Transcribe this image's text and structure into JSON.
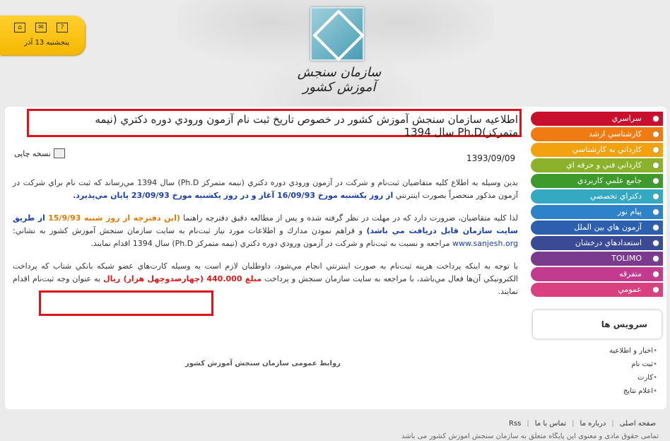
{
  "corner": {
    "date": "پنجشنبه 13 آذر",
    "icons": [
      "help-icon",
      "mail-icon",
      "home-icon"
    ]
  },
  "logo": {
    "text": "سازمان سنجش آموزش کشور"
  },
  "article": {
    "title": "اطلاعيه سازمان سنجش آموزش كشور در خصوص تاريخ ثبت نام آزمون ورودي دوره دكتري (نيمه متمركز)Ph.D سال 1394",
    "print_label": "نسخه چاپی",
    "date": "1393/09/09",
    "p1_a": "بدين وسيله به اطلاع كليه متقاضيان ثبت‌نام و شركت در آزمون ورودي دوره دكتري (نيمه متمركز Ph.D) سال 1394 مي‌رساند كه ثبت نام براي شركت در آزمون مذكور منحصراً بصورت اينترنتي",
    "p1_b": "از روز يكشنبه مورخ 16/09/93 آغاز و در روز يكشنبه مورخ 23/09/93 پايان مي‌پذيرد.",
    "p2_a": "لذا كليه متقاضيان، ضرورت دارد كه در مهلت در نظر گرفته شده و پس از مطالعه دقيق دفترچه راهنما",
    "p2_b": "(اين دفترچه از روز شنبه 15/9/93",
    "p2_c": "از طريق سايت سازمان قابل دريافت مي باشد)",
    "p2_d": "و فراهم نمودن مدارك و اطلاعات مورد نياز ثبت‌نام به سايت سازمان سنجش آموزش كشور به نشاني:",
    "p2_link": "www.sanjesh.org",
    "p2_e": "مراجعه و نسبت به ثبت‌نام و شركت در آزمون ورودي دوره دكتري (نيمه متمركز Ph.D) سال 1394 اقدام نمايند.",
    "p3_a": "با توجه به اينكه پرداخت هزينه ثبت‌نام به صورت اينترنتي انجام مي‌شود، داوطلبان لازم است به وسيله كارت‌هاي عضو شبكه بانكي شتاب كه پرداخت الكترونيكي آن‌ها فعال مي‌باشد، با مراجعه به سايت سازمان سنجش و پرداخت",
    "p3_b": "مبلغ 440.000 (چهارصدوچهل هزار) ريال",
    "p3_c": "به عنوان وجه ثبت‌نام اقدام نمايند.",
    "signature": "روابط عمومی سازمان سنجش آموزش کشور"
  },
  "menu": {
    "items": [
      {
        "label": "سراسري",
        "color": "#c8102e"
      },
      {
        "label": "كارشناسي ارشد",
        "color": "#f07b12"
      },
      {
        "label": "كارداني به كارشناسي",
        "color": "#f2a20f"
      },
      {
        "label": "كارداني فني و حرفه اي",
        "color": "#8bb22a"
      },
      {
        "label": "جامع علمي كاربردي",
        "color": "#3f9a2c"
      },
      {
        "label": "دكتراي تخصصي",
        "color": "#36a9c2"
      },
      {
        "label": "پيام نور",
        "color": "#2e82c9"
      },
      {
        "label": "آزمون هاي بين الملل",
        "color": "#2c5fae"
      },
      {
        "label": "استعدادهاي درخشان",
        "color": "#3a4a94"
      },
      {
        "label": "TOLIMO",
        "color": "#7a3b8f"
      },
      {
        "label": "متفرقه",
        "color": "#c23b8e"
      },
      {
        "label": "عمومي",
        "color": "#d9407f"
      }
    ]
  },
  "services": {
    "title": "سرويس ها",
    "items": [
      "اخبار و اطلاعيه",
      "ثبت نام",
      "كارت",
      "اعلام نتايج"
    ]
  },
  "footer": {
    "links": [
      "صفحه اصلی",
      "درباره ما",
      "تماس با ما",
      "Rss"
    ],
    "copyright": "تمامی حقوق مادی و معنوی این پایگاه متعلق به سازمان سنجش آموزش کشور می باشد"
  }
}
